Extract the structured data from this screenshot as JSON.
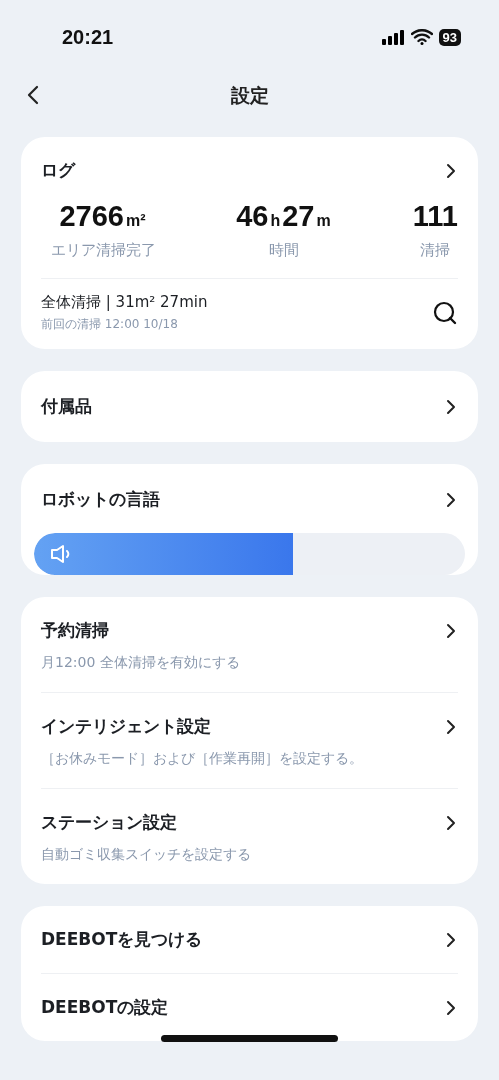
{
  "status_bar": {
    "time": "20:21",
    "battery": "93"
  },
  "header": {
    "title": "設定"
  },
  "log": {
    "title": "ログ",
    "stats": [
      {
        "parts": [
          {
            "kind": "number",
            "text": "2766"
          },
          {
            "kind": "unit",
            "text": "m²"
          }
        ],
        "label": "エリア清掃完了"
      },
      {
        "parts": [
          {
            "kind": "number",
            "text": "46"
          },
          {
            "kind": "unit",
            "text": "h"
          },
          {
            "kind": "number",
            "text": "27"
          },
          {
            "kind": "unit",
            "text": "m"
          }
        ],
        "label": "時間"
      },
      {
        "parts": [
          {
            "kind": "number",
            "text": "111"
          }
        ],
        "label": "清掃"
      }
    ],
    "last_clean": {
      "summary": "全体清掃 | 31m² 27min",
      "detail": "前回の清掃 12:00 10/18"
    }
  },
  "accessories": {
    "title": "付属品"
  },
  "robot_language": {
    "title": "ロボットの言語",
    "volume": {
      "level": 0.6
    }
  },
  "settings": [
    {
      "title": "予約清掃",
      "subtitle": "月12:00 全体清掃を有効にする"
    },
    {
      "title": "インテリジェント設定",
      "subtitle": "［お休みモード］および［作業再開］を設定する。"
    },
    {
      "title": "ステーション設定",
      "subtitle": "自動ゴミ収集スイッチを設定する"
    }
  ],
  "more": [
    {
      "title": "DEEBOTを見つける"
    },
    {
      "title": "DEEBOTの設定"
    }
  ]
}
